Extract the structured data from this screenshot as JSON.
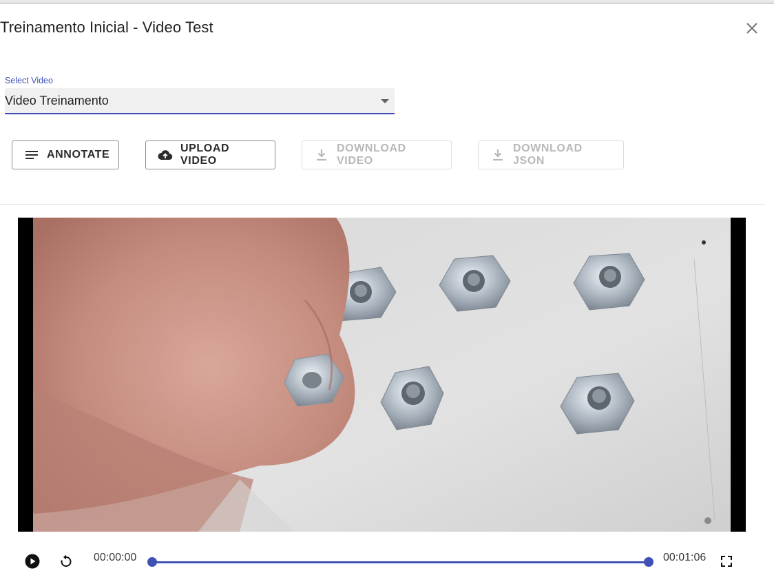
{
  "dialog": {
    "title": "Treinamento Inicial - Video Test",
    "close_icon": "close-icon"
  },
  "select": {
    "label": "Select Video",
    "value": "Video Treinamento"
  },
  "toolbar": {
    "annotate_label": "ANNOTATE",
    "annotate_icon": "lines-icon",
    "upload_label": "UPLOAD VIDEO",
    "upload_icon": "cloud-upload-icon",
    "download_video_label": "DOWNLOAD VIDEO",
    "download_json_label": "DOWNLOAD JSON",
    "download_icon": "download-icon"
  },
  "player": {
    "current_time": "00:00:00",
    "end_time": "00:01:06",
    "range_start_fraction": 0,
    "range_end_fraction": 1
  },
  "colors": {
    "accent": "#3f51b5",
    "disabled_text": "#b8b8b8"
  }
}
